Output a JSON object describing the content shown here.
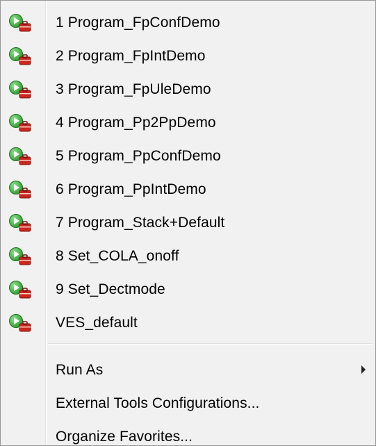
{
  "favorites": [
    {
      "label": "1 Program_FpConfDemo",
      "icon": "run-config-icon"
    },
    {
      "label": "2 Program_FpIntDemo",
      "icon": "run-config-icon"
    },
    {
      "label": "3 Program_FpUleDemo",
      "icon": "run-config-icon"
    },
    {
      "label": "4 Program_Pp2PpDemo",
      "icon": "run-config-icon"
    },
    {
      "label": "5 Program_PpConfDemo",
      "icon": "run-config-icon"
    },
    {
      "label": "6 Program_PpIntDemo",
      "icon": "run-config-icon"
    },
    {
      "label": "7 Program_Stack+Default",
      "icon": "run-config-icon"
    },
    {
      "label": "8 Set_COLA_onoff",
      "icon": "run-config-icon"
    },
    {
      "label": "9 Set_Dectmode",
      "icon": "run-config-icon"
    },
    {
      "label": "VES_default",
      "icon": "run-config-icon"
    }
  ],
  "actions": {
    "run_as": "Run As",
    "external_tools": "External Tools Configurations...",
    "organize": "Organize Favorites..."
  },
  "colors": {
    "menu_bg": "#f1f1f1",
    "run_green": "#2e9a2e",
    "toolbox_red": "#c8281e"
  }
}
